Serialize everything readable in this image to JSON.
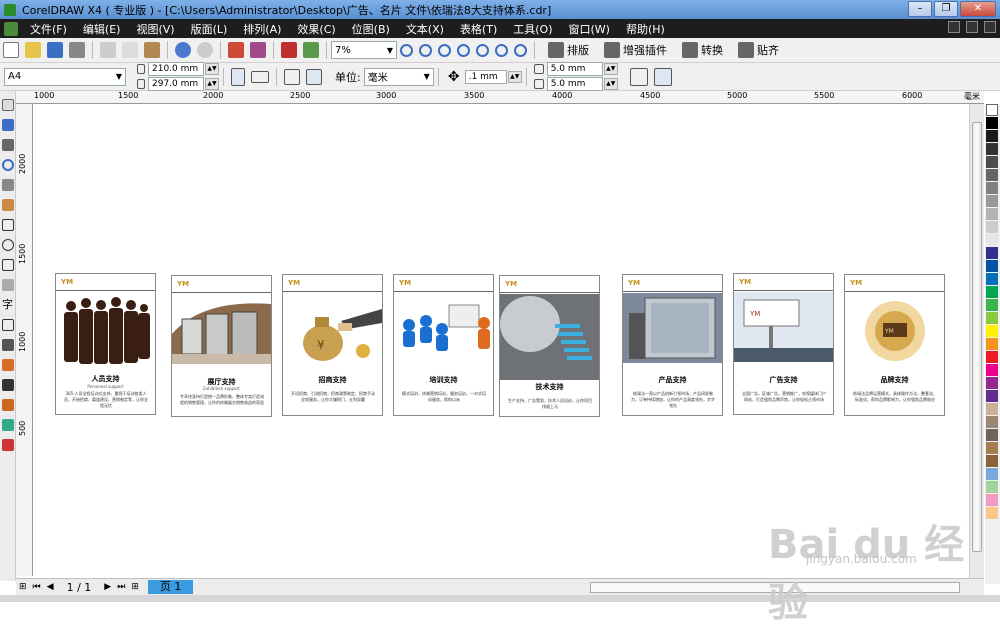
{
  "window": {
    "title": "CorelDRAW X4 ( 专业版 ) - [C:\\Users\\Administrator\\Desktop\\广告、名片 文件\\依瑞法8大支持体系.cdr]"
  },
  "menu": [
    "文件(F)",
    "编辑(E)",
    "视图(V)",
    "版面(L)",
    "排列(A)",
    "效果(C)",
    "位图(B)",
    "文本(X)",
    "表格(T)",
    "工具(O)",
    "窗口(W)",
    "帮助(H)"
  ],
  "toolbar": {
    "zoom": "7%",
    "plugins": [
      "排版",
      "增强插件",
      "转换",
      "贴齐"
    ]
  },
  "propertybar": {
    "paper_size": "A4",
    "width": "210.0 mm",
    "height": "297.0 mm",
    "units_label": "单位:",
    "units": "毫米",
    "nudge": ".1 mm",
    "dup_x": "5.0 mm",
    "dup_y": "5.0 mm"
  },
  "ruler": {
    "h_ticks": [
      "1000",
      "1500",
      "2000",
      "2500",
      "3000",
      "3500",
      "4000",
      "4500",
      "5000",
      "5500",
      "6000",
      "毫米"
    ],
    "v_ticks": [
      "2000",
      "1500",
      "1000",
      "500"
    ]
  },
  "page_nav": {
    "counter": "1 / 1",
    "tab": "页 1"
  },
  "palette": [
    "#ffffff",
    "#000000",
    "#1a1a1a",
    "#333333",
    "#4d4d4d",
    "#666666",
    "#808080",
    "#999999",
    "#b3b3b3",
    "#cccccc",
    "#e6e6e6",
    "#2e3192",
    "#0054a6",
    "#0072bc",
    "#00a651",
    "#39b54a",
    "#8dc63f",
    "#fff200",
    "#f7941d",
    "#ed1c24",
    "#ec008c",
    "#92278f",
    "#662d91",
    "#c7b299",
    "#998675",
    "#736357",
    "#a67c52",
    "#8c6239",
    "#7da7d9",
    "#a3d39c",
    "#f49ac2",
    "#fdc689"
  ],
  "cards": [
    {
      "title": "人员支持",
      "subtitle": "Personnel support",
      "text": "365 人员全程培训式支持，重视于培训各类人员，开始招商、渠道建设、营销制定等，让你全程无忧"
    },
    {
      "title": "展厅支持",
      "subtitle": "Exhibition support",
      "text": "专享终身持打造统一品牌形象，整体专卖打造流程的销售管理，让你的终端展台销售效益的家居"
    },
    {
      "title": "招商支持",
      "subtitle": "",
      "text": "开设招商、引流招商，招商政策制定、招商手动全程服务，让你大赚财门，五利双赢"
    },
    {
      "title": "培训支持",
      "subtitle": "",
      "text": "模式培训，终端营销培训，服务培训，一对式培训服务，帮你以赤"
    },
    {
      "title": "技术支持",
      "subtitle": "",
      "text": "生产支持，广告策划，技术人员培训，让你项目排顺上马"
    },
    {
      "title": "产品支持",
      "subtitle": "",
      "text": "依瑞法一直以产品创新引领市场，产品研发聚力，订单持续增加，让你的产品高度领先，步步领先"
    },
    {
      "title": "广告支持",
      "subtitle": "",
      "text": "全国广告，区域广告，营销推广，央视媒体门户网站，打造强势品牌声势，让你轻松占领市场"
    },
    {
      "title": "品牌支持",
      "subtitle": "",
      "text": "依瑞法品牌运营模式，具体操作方法，整套化、标准化，帮你品牌影响力，让你强势品牌效应"
    }
  ],
  "watermark": {
    "main": "Bai du 经验",
    "sub": "jingyan.baidu.com"
  }
}
